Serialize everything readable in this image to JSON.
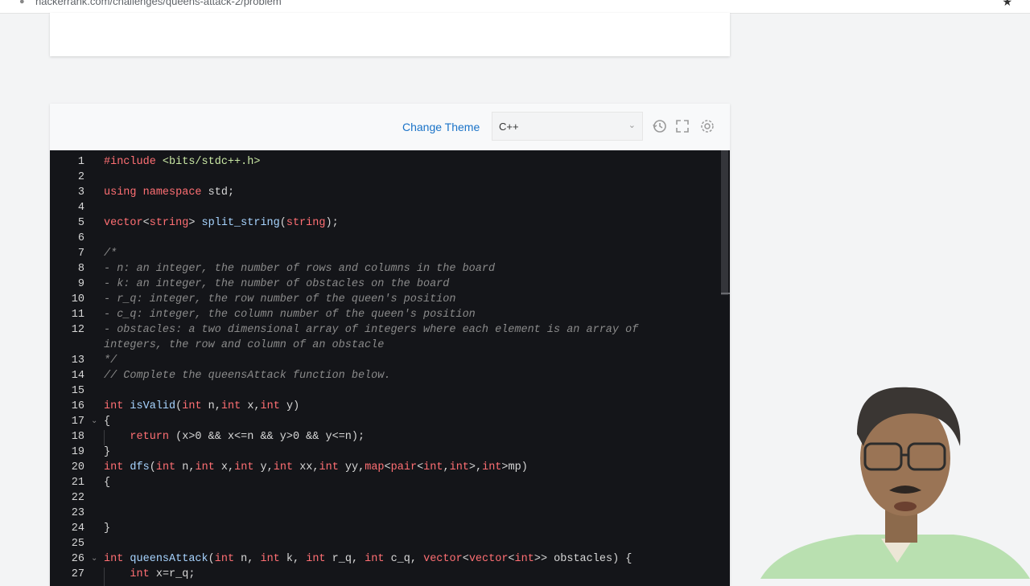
{
  "browser": {
    "url": "hackerrank.com/challenges/queens-attack-2/problem"
  },
  "toolbar": {
    "change_theme": "Change Theme",
    "language": "C++"
  },
  "code_lines": [
    {
      "n": "1",
      "t": "#include <bits/stdc++.h>"
    },
    {
      "n": "2",
      "t": ""
    },
    {
      "n": "3",
      "t": "using namespace std;"
    },
    {
      "n": "4",
      "t": ""
    },
    {
      "n": "5",
      "t": "vector<string> split_string(string);"
    },
    {
      "n": "6",
      "t": ""
    },
    {
      "n": "7",
      "t": "/*"
    },
    {
      "n": "8",
      "t": "- n: an integer, the number of rows and columns in the board"
    },
    {
      "n": "9",
      "t": "- k: an integer, the number of obstacles on the board"
    },
    {
      "n": "10",
      "t": "- r_q: integer, the row number of the queen's position"
    },
    {
      "n": "11",
      "t": "- c_q: integer, the column number of the queen's position"
    },
    {
      "n": "12",
      "t": "- obstacles: a two dimensional array of integers where each element is an array of"
    },
    {
      "n": "",
      "t": "integers, the row and column of an obstacle"
    },
    {
      "n": "13",
      "t": "*/"
    },
    {
      "n": "14",
      "t": "// Complete the queensAttack function below."
    },
    {
      "n": "15",
      "t": ""
    },
    {
      "n": "16",
      "t": "int isValid(int n,int x,int y)"
    },
    {
      "n": "17",
      "t": "{"
    },
    {
      "n": "18",
      "t": "    return (x>0 && x<=n && y>0 && y<=n);"
    },
    {
      "n": "19",
      "t": "}"
    },
    {
      "n": "20",
      "t": "int dfs(int n,int x,int y,int xx,int yy,map<pair<int,int>,int>mp)"
    },
    {
      "n": "21",
      "t": "{"
    },
    {
      "n": "22",
      "t": ""
    },
    {
      "n": "23",
      "t": ""
    },
    {
      "n": "24",
      "t": "}"
    },
    {
      "n": "25",
      "t": ""
    },
    {
      "n": "26",
      "t": "int queensAttack(int n, int k, int r_q, int c_q, vector<vector<int>> obstacles) {"
    },
    {
      "n": "27",
      "t": "    int x=r_q;"
    }
  ],
  "icons": {
    "history": "history-icon",
    "fullscreen": "fullscreen-icon",
    "settings": "gear-icon",
    "fold": "chevron-down-icon"
  }
}
